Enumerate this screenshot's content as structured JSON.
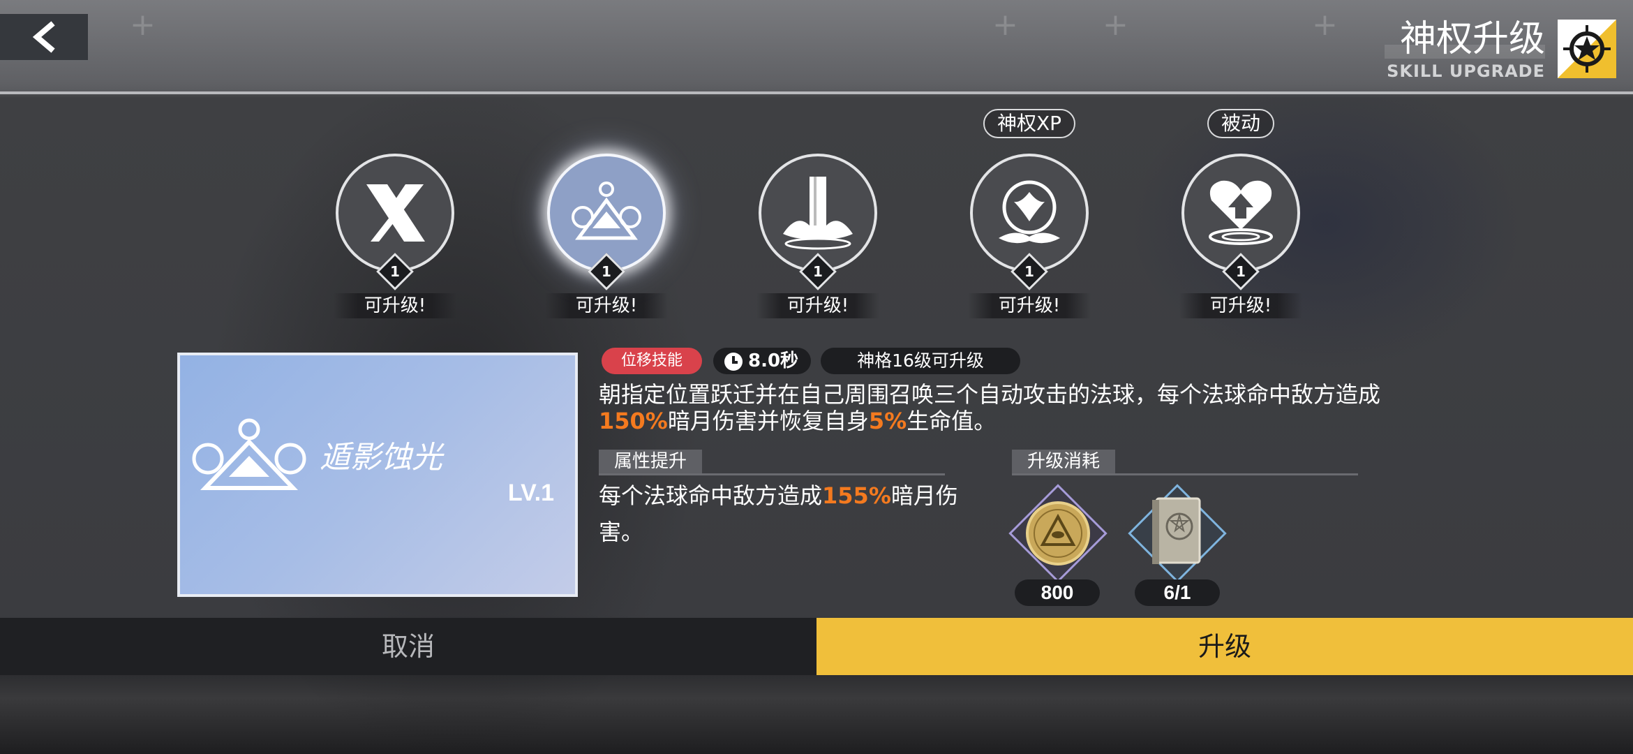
{
  "header": {
    "title": "神权升级",
    "subtitle": "SKILL UPGRADE",
    "back_icon": "chevron-left-icon",
    "emblem_icon": "skill-emblem-icon"
  },
  "skills": [
    {
      "name": "cross-blades-skill",
      "icon": "cross-blades-icon",
      "level": "1",
      "status": "可升级!",
      "tag": "",
      "active": false
    },
    {
      "name": "orb-summon-skill",
      "icon": "orb-triangle-icon",
      "level": "1",
      "status": "可升级!",
      "tag": "",
      "active": true
    },
    {
      "name": "pillar-burst-skill",
      "icon": "pillar-burst-icon",
      "level": "1",
      "status": "可升级!",
      "tag": "",
      "active": false
    },
    {
      "name": "phoenix-orb-skill",
      "icon": "phoenix-orb-icon",
      "level": "1",
      "status": "可升级!",
      "tag": "神权XP",
      "active": false
    },
    {
      "name": "heart-up-skill",
      "icon": "heart-up-icon",
      "level": "1",
      "status": "可升级!",
      "tag": "被动",
      "active": false
    }
  ],
  "detail": {
    "card_name": "遁影蚀光",
    "card_level": "LV.1",
    "type_badge": "位移技能",
    "cooldown": "8.0秒",
    "requirement": "神格16级可升级",
    "desc_line1": "朝指定位置跃迁并在自己周围召唤三个自动攻击的法球，每个法球命中敌方造成",
    "desc_pct1": "150%",
    "desc_mid": "暗月伤害并恢复自身",
    "desc_pct2": "5%",
    "desc_end": "生命值。"
  },
  "attribute": {
    "header": "属性提升",
    "text_pre": "每个法球命中敌方造成",
    "text_pct": "155%",
    "text_post": "暗月伤害。"
  },
  "cost": {
    "header": "升级消耗",
    "items": [
      {
        "icon": "gold-coin-icon",
        "value": "800",
        "border": "#a69bd8"
      },
      {
        "icon": "skill-book-icon",
        "value": "6/1",
        "border": "#7fb4de"
      }
    ]
  },
  "buttons": {
    "cancel": "取消",
    "upgrade": "升级"
  },
  "colors": {
    "accent": "#f0bf3b",
    "highlight": "#f47a1f",
    "badge_red": "#d9424b"
  }
}
